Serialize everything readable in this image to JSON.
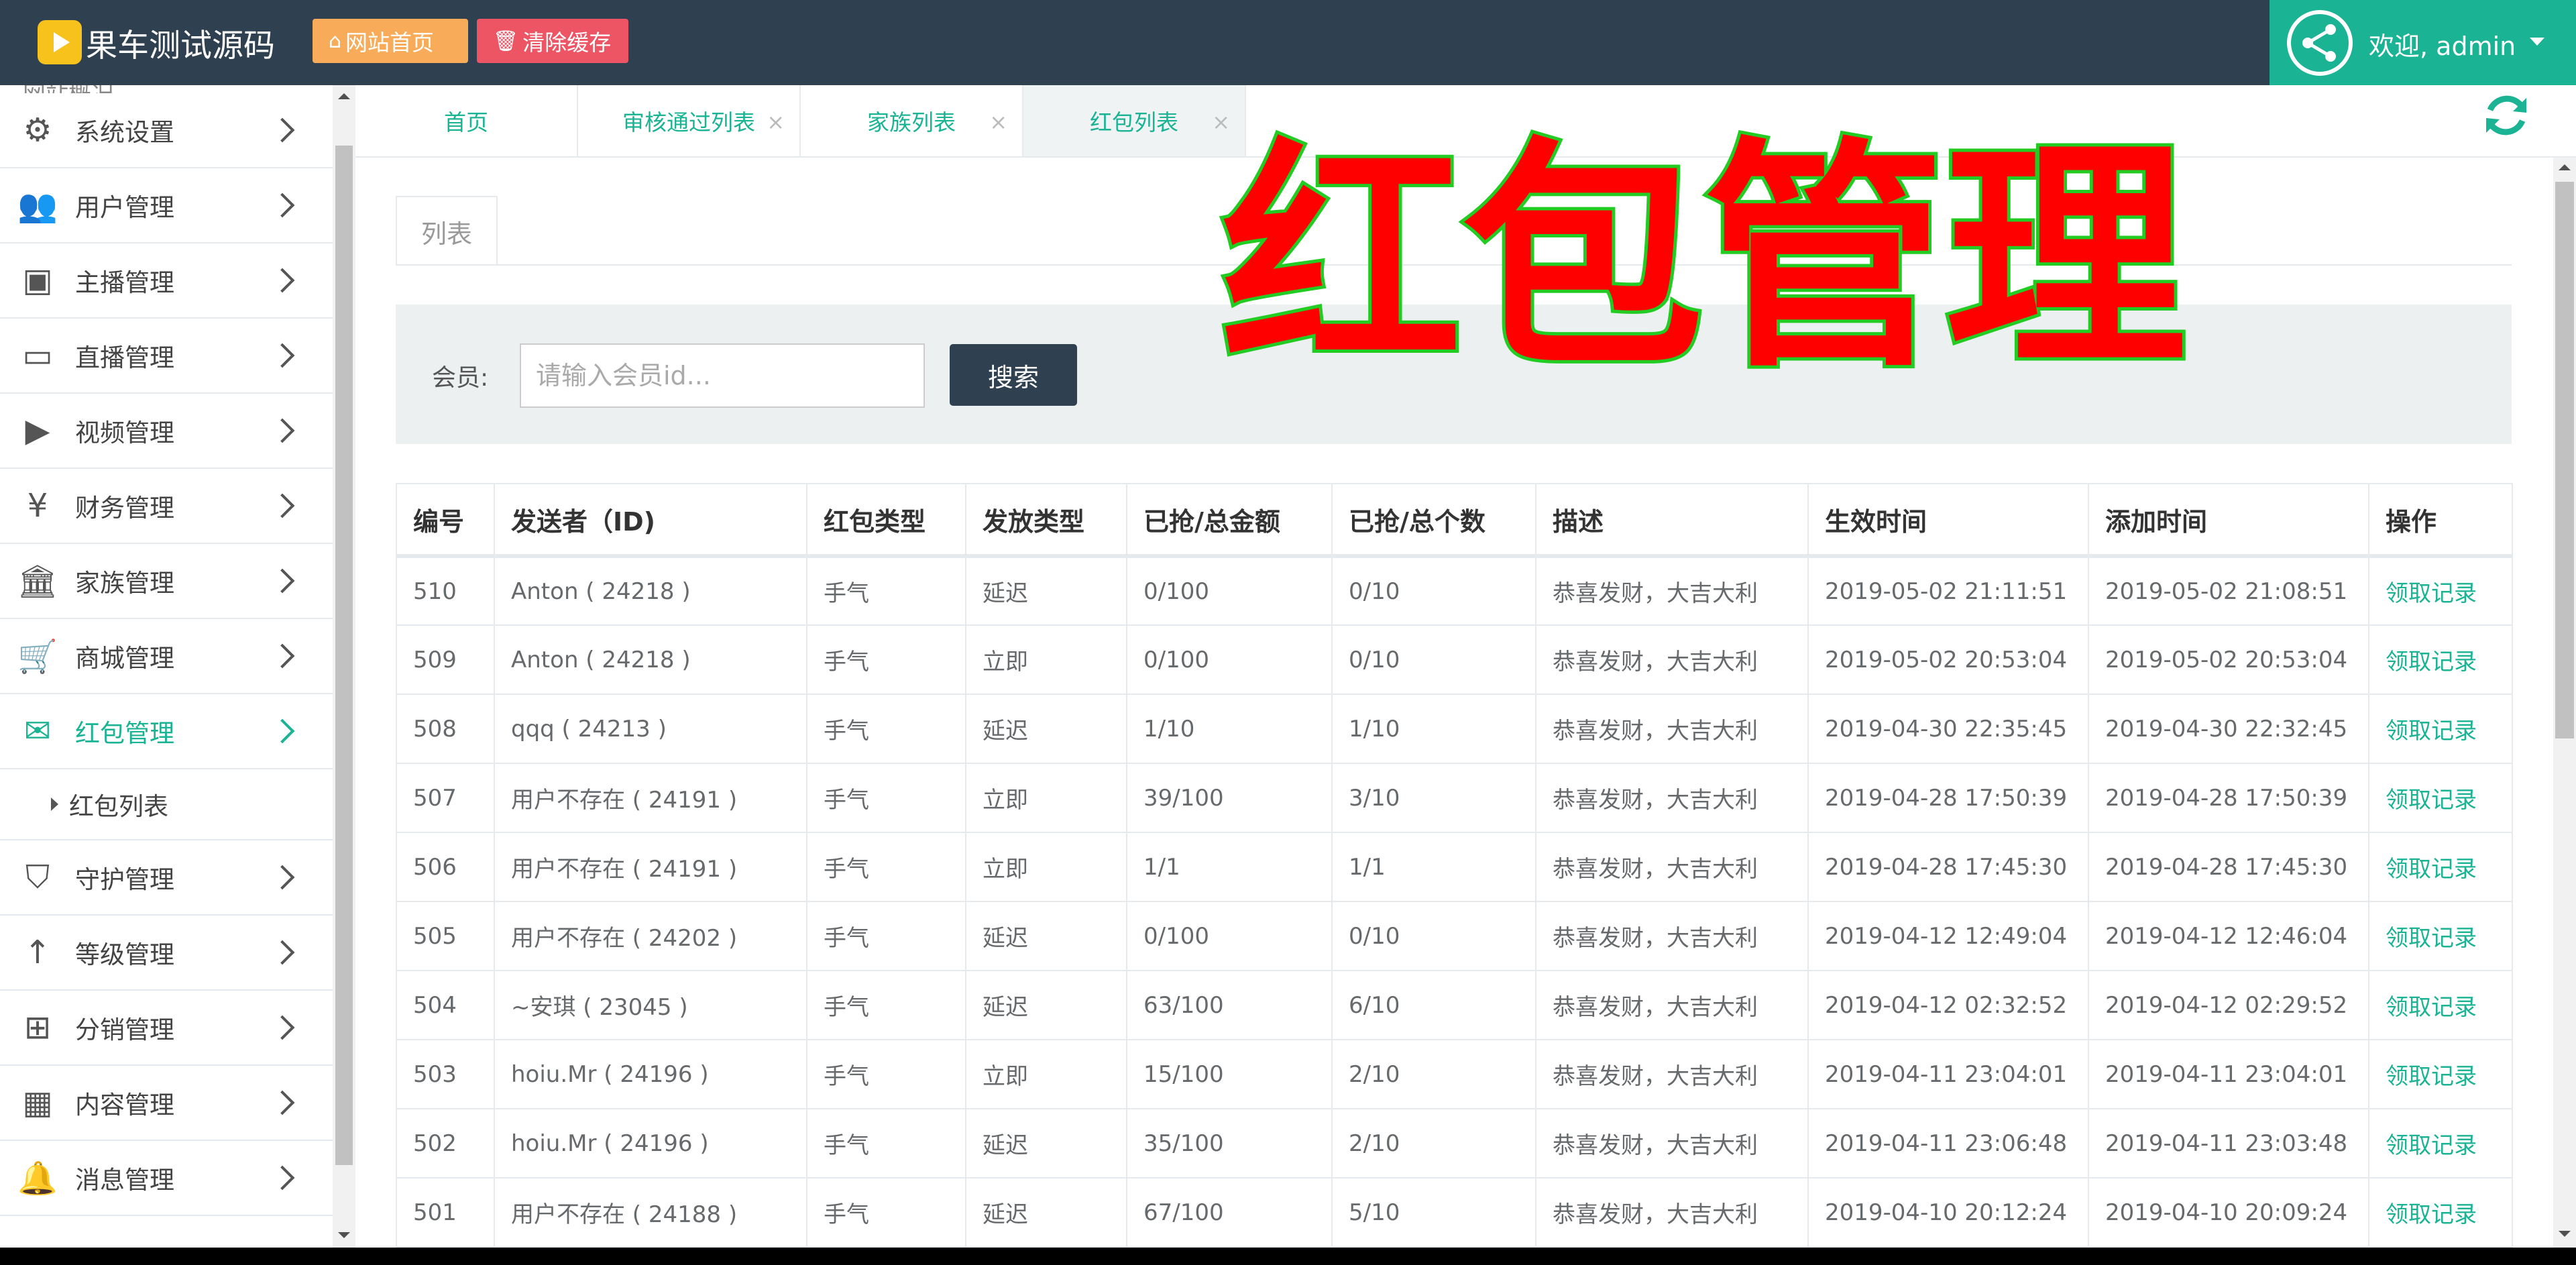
{
  "header": {
    "brand": "果车测试源码",
    "home_btn": "网站首页",
    "clear_btn": "清除缓存",
    "welcome": "欢迎, admin"
  },
  "sidebar": {
    "partial_top": "网站概况",
    "items": [
      {
        "label": "系统设置",
        "icon": "gears-icon"
      },
      {
        "label": "用户管理",
        "icon": "users-icon"
      },
      {
        "label": "主播管理",
        "icon": "id-badge-icon"
      },
      {
        "label": "直播管理",
        "icon": "monitor-icon"
      },
      {
        "label": "视频管理",
        "icon": "video-camera-icon"
      },
      {
        "label": "财务管理",
        "icon": "yen-icon"
      },
      {
        "label": "家族管理",
        "icon": "bank-icon"
      },
      {
        "label": "商城管理",
        "icon": "cart-icon"
      },
      {
        "label": "红包管理",
        "icon": "envelope-icon",
        "active": true
      },
      {
        "label": "守护管理",
        "icon": "shield-icon"
      },
      {
        "label": "等级管理",
        "icon": "level-up-icon"
      },
      {
        "label": "分销管理",
        "icon": "sitemap-icon"
      },
      {
        "label": "内容管理",
        "icon": "grid-icon"
      },
      {
        "label": "消息管理",
        "icon": "bell-icon"
      }
    ],
    "sub_item": "红包列表"
  },
  "tabs": [
    {
      "label": "首页",
      "closable": false
    },
    {
      "label": "审核通过列表",
      "closable": true
    },
    {
      "label": "家族列表",
      "closable": true
    },
    {
      "label": "红包列表",
      "closable": true,
      "active": true
    }
  ],
  "page": {
    "list_tab": "列表",
    "overlay_title": "红包管理",
    "member_label": "会员:",
    "member_placeholder": "请输入会员id...",
    "search_btn": "搜索"
  },
  "table": {
    "columns": [
      "编号",
      "发送者（ID)",
      "红包类型",
      "发放类型",
      "已抢/总金额",
      "已抢/总个数",
      "描述",
      "生效时间",
      "添加时间",
      "操作"
    ],
    "rows": [
      [
        "510",
        "Anton ( 24218 )",
        "手气",
        "延迟",
        "0/100",
        "0/10",
        "恭喜发财，大吉大利",
        "2019-05-02 21:11:51",
        "2019-05-02 21:08:51",
        "领取记录"
      ],
      [
        "509",
        "Anton ( 24218 )",
        "手气",
        "立即",
        "0/100",
        "0/10",
        "恭喜发财，大吉大利",
        "2019-05-02 20:53:04",
        "2019-05-02 20:53:04",
        "领取记录"
      ],
      [
        "508",
        "qqq ( 24213 )",
        "手气",
        "延迟",
        "1/10",
        "1/10",
        "恭喜发财，大吉大利",
        "2019-04-30 22:35:45",
        "2019-04-30 22:32:45",
        "领取记录"
      ],
      [
        "507",
        "用户不存在 ( 24191 )",
        "手气",
        "立即",
        "39/100",
        "3/10",
        "恭喜发财，大吉大利",
        "2019-04-28 17:50:39",
        "2019-04-28 17:50:39",
        "领取记录"
      ],
      [
        "506",
        "用户不存在 ( 24191 )",
        "手气",
        "立即",
        "1/1",
        "1/1",
        "恭喜发财，大吉大利",
        "2019-04-28 17:45:30",
        "2019-04-28 17:45:30",
        "领取记录"
      ],
      [
        "505",
        "用户不存在 ( 24202 )",
        "手气",
        "延迟",
        "0/100",
        "0/10",
        "恭喜发财，大吉大利",
        "2019-04-12 12:49:04",
        "2019-04-12 12:46:04",
        "领取记录"
      ],
      [
        "504",
        "~安琪 ( 23045 )",
        "手气",
        "延迟",
        "63/100",
        "6/10",
        "恭喜发财，大吉大利",
        "2019-04-12 02:32:52",
        "2019-04-12 02:29:52",
        "领取记录"
      ],
      [
        "503",
        "hoiu.Mr ( 24196 )",
        "手气",
        "立即",
        "15/100",
        "2/10",
        "恭喜发财，大吉大利",
        "2019-04-11 23:04:01",
        "2019-04-11 23:04:01",
        "领取记录"
      ],
      [
        "502",
        "hoiu.Mr ( 24196 )",
        "手气",
        "延迟",
        "35/100",
        "2/10",
        "恭喜发财，大吉大利",
        "2019-04-11 23:06:48",
        "2019-04-11 23:03:48",
        "领取记录"
      ],
      [
        "501",
        "用户不存在 ( 24188 )",
        "手气",
        "延迟",
        "67/100",
        "5/10",
        "恭喜发财，大吉大利",
        "2019-04-10 20:12:24",
        "2019-04-10 20:09:24",
        "领取记录"
      ]
    ]
  },
  "colors": {
    "header_bg": "#2f4050",
    "accent": "#1ab394",
    "home_btn": "#f8ac59",
    "clear_btn": "#ed5565",
    "overlay_fill": "#ff0000",
    "overlay_stroke": "#22cc22"
  }
}
